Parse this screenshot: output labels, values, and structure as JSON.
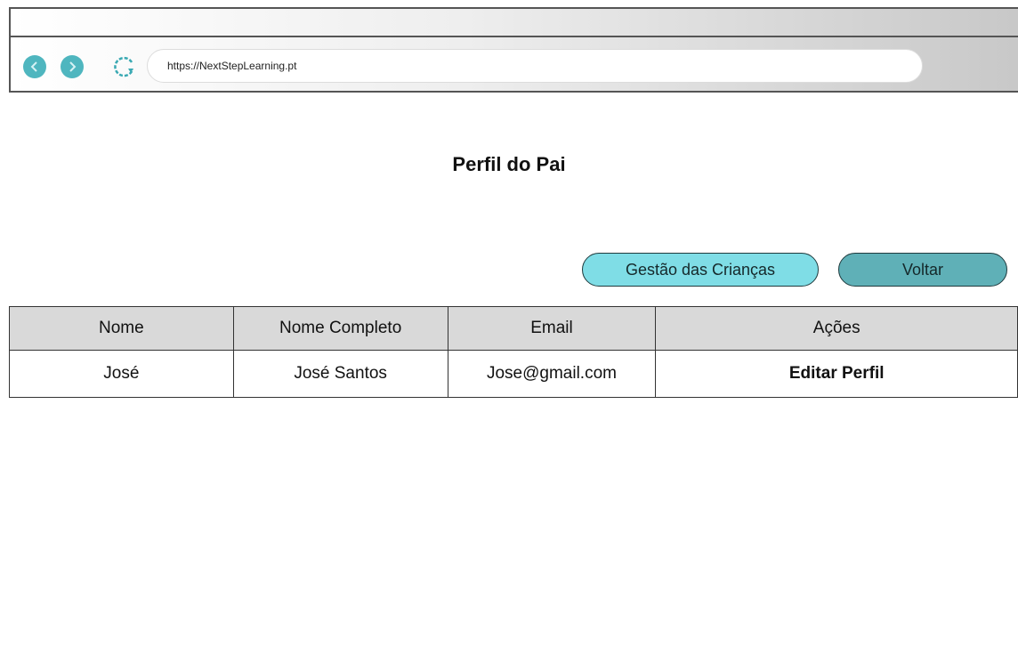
{
  "browser": {
    "url": "https://NextStepLearning.pt"
  },
  "page": {
    "title": "Perfil do Pai"
  },
  "actions": {
    "manage_children_label": "Gestão das Crianças",
    "back_label": "Voltar"
  },
  "table": {
    "headers": [
      "Nome",
      "Nome Completo",
      "Email",
      "Ações"
    ],
    "rows": [
      {
        "nome": "José",
        "nome_completo": "José Santos",
        "email": "Jose@gmail.com",
        "acao": "Editar Perfil"
      }
    ]
  },
  "colors": {
    "nav_button": "#4fb6bf",
    "primary_button": "#7fdde6",
    "secondary_button": "#5fb0b7",
    "table_header": "#d9d9d9"
  }
}
